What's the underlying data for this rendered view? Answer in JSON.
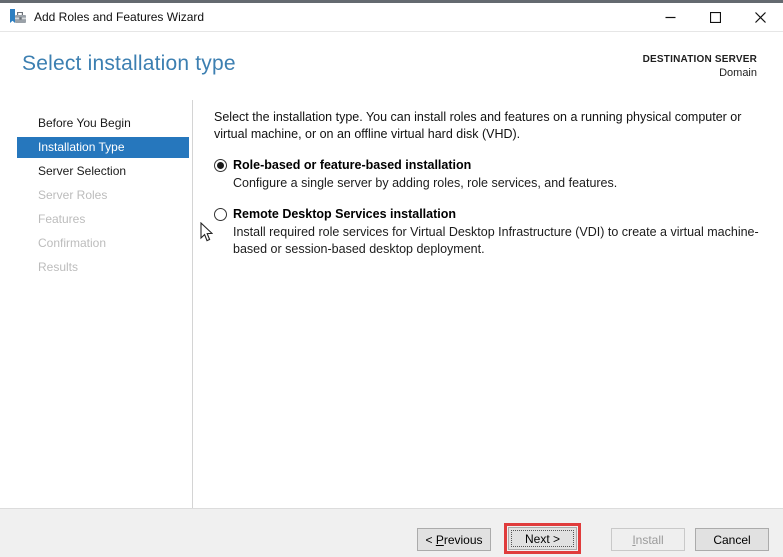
{
  "window": {
    "title": "Add Roles and Features Wizard",
    "icon": "server-manager-toolbox-icon",
    "controls": [
      "minimize",
      "maximize",
      "close"
    ]
  },
  "header": {
    "title": "Select installation type",
    "destination_label": "DESTINATION SERVER",
    "destination_value": "Domain"
  },
  "sidebar": {
    "items": [
      {
        "label": "Before You Begin",
        "state": "enabled"
      },
      {
        "label": "Installation Type",
        "state": "selected"
      },
      {
        "label": "Server Selection",
        "state": "enabled"
      },
      {
        "label": "Server Roles",
        "state": "disabled"
      },
      {
        "label": "Features",
        "state": "disabled"
      },
      {
        "label": "Confirmation",
        "state": "disabled"
      },
      {
        "label": "Results",
        "state": "disabled"
      }
    ]
  },
  "main": {
    "intro": "Select the installation type. You can install roles and features on a running physical computer or virtual machine, or on an offline virtual hard disk (VHD).",
    "options": [
      {
        "label": "Role-based or feature-based installation",
        "selected": true,
        "description": "Configure a single server by adding roles, role services, and features."
      },
      {
        "label": "Remote Desktop Services installation",
        "selected": false,
        "description": "Install required role services for Virtual Desktop Infrastructure (VDI) to create a virtual machine-based or session-based desktop deployment."
      }
    ]
  },
  "footer": {
    "previous": {
      "pre": "< ",
      "mnemonic": "P",
      "rest": "revious"
    },
    "next": {
      "pre": "",
      "mnemonic": "N",
      "rest": "ext >"
    },
    "install": {
      "pre": "",
      "mnemonic": "I",
      "rest": "nstall"
    },
    "cancel": {
      "label": "Cancel"
    },
    "next_button_state": "focused-and-highlighted",
    "install_button_state": "disabled"
  },
  "colors": {
    "heading_blue": "#3C7FB1",
    "selected_nav_blue": "#2677BD",
    "annotation_red": "#E03C3C",
    "footer_gray": "#F0F0F0",
    "top_strip_gray": "#646A70"
  }
}
